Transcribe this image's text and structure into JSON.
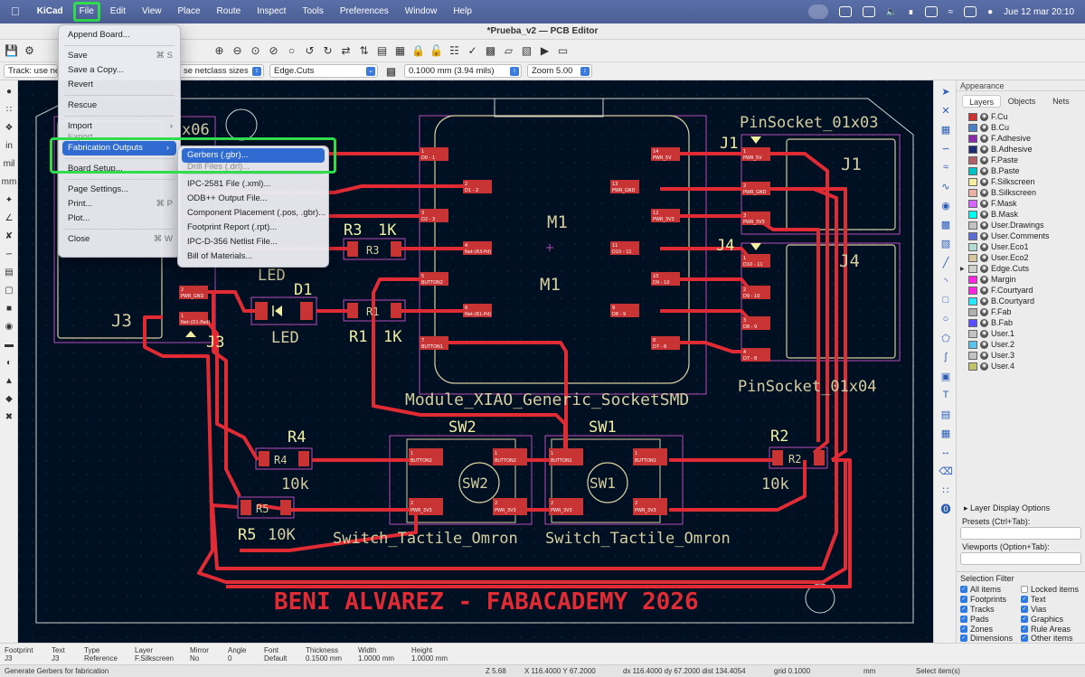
{
  "menubar": {
    "apple": "",
    "app": "KiCad",
    "items": [
      "File",
      "Edit",
      "View",
      "Place",
      "Route",
      "Inspect",
      "Tools",
      "Preferences",
      "Window",
      "Help"
    ],
    "datetime": "Jue 12 mar 20:10"
  },
  "window": {
    "title": "*Prueba_v2 — PCB Editor"
  },
  "toolbar2": {
    "track": "Track: use net",
    "via": "se netclass sizes",
    "layer": "Edge.Cuts",
    "grid": "0.1000 mm (3.94 mils)",
    "zoom": "Zoom 5.00"
  },
  "file_menu": {
    "items": [
      {
        "label": "Append Board...",
        "shortcut": ""
      },
      {
        "label": "Save",
        "shortcut": "⌘ S"
      },
      {
        "label": "Save a Copy...",
        "shortcut": ""
      },
      {
        "label": "Revert",
        "shortcut": ""
      },
      {
        "label": "Rescue",
        "shortcut": ""
      },
      {
        "label": "Import",
        "shortcut": ""
      },
      {
        "label": "Export",
        "shortcut": ""
      },
      {
        "label": "Fabrication Outputs",
        "shortcut": ""
      },
      {
        "label": "Board Setup...",
        "shortcut": ""
      },
      {
        "label": "Page Settings...",
        "shortcut": ""
      },
      {
        "label": "Print...",
        "shortcut": "⌘ P"
      },
      {
        "label": "Plot...",
        "shortcut": ""
      },
      {
        "label": "Close",
        "shortcut": "⌘ W"
      }
    ]
  },
  "fab_menu": {
    "items": [
      "Gerbers (.gbr)...",
      "Drill Files (.drl)...",
      "IPC-2581 File (.xml)...",
      "ODB++ Output File...",
      "Component Placement (.pos, .gbr)...",
      "Footprint Report (.rpt)...",
      "IPC-D-356 Netlist File...",
      "Bill of Materials..."
    ]
  },
  "pcb": {
    "refs": {
      "j1": "J1",
      "j1_name": "PinSocket_01x03",
      "j4": "J4",
      "j4_name": "PinSocket_01x04",
      "j3": "J3",
      "m1": "M1",
      "m1_name": "Module_XIAO_Generic_SocketSMD",
      "r3": "R3",
      "r3_val": "1K",
      "d1": "D1",
      "d1_val": "LED",
      "r1": "R1",
      "r1_val": "1K",
      "r4": "R4",
      "r4_val": "10k",
      "r5": "R5",
      "r5_val": "10K",
      "sw1": "SW1",
      "sw2": "SW2",
      "sw_name": "Switch_Tactile_Omron",
      "r2": "R2",
      "r2_val": "10k",
      "j3_name_part": "x06",
      "footer": "BENI ALVAREZ - FABACADEMY 2026"
    },
    "m1_left_pads": [
      {
        "num": "1",
        "net": "D0 - 1"
      },
      {
        "num": "2",
        "net": "D1 - 2"
      },
      {
        "num": "3",
        "net": "D2 - 3"
      },
      {
        "num": "4",
        "net": "Net-(R3-Pd)"
      },
      {
        "num": "5",
        "net": "BUTTON2"
      },
      {
        "num": "6",
        "net": "Net-(R1-Pd)"
      },
      {
        "num": "7",
        "net": "BUTTON1"
      }
    ],
    "m1_right_pads": [
      {
        "num": "14",
        "net": "PWR_5V"
      },
      {
        "num": "13",
        "net": "PWR_GND"
      },
      {
        "num": "12",
        "net": "PWR_3V3"
      },
      {
        "num": "11",
        "net": "D10 - 11"
      },
      {
        "num": "10",
        "net": "D9 - 10"
      },
      {
        "num": "9",
        "net": "D8 - 9"
      },
      {
        "num": "8",
        "net": "D7 - 8"
      }
    ],
    "j1_pads": [
      {
        "num": "1",
        "net": "PWR_5V"
      },
      {
        "num": "2",
        "net": "PWR_GND"
      },
      {
        "num": "3",
        "net": "PWR_3V3"
      }
    ],
    "j4_pads": [
      {
        "num": "1",
        "net": "D10 - 11"
      },
      {
        "num": "2",
        "net": "D9 - 10"
      },
      {
        "num": "3",
        "net": "D8 - 9"
      },
      {
        "num": "4",
        "net": "D7 - 8"
      }
    ],
    "j3_pads": [
      {
        "num": "2",
        "net": "PWR_GND"
      },
      {
        "num": "1",
        "net": "Net-(D1-Pad)"
      }
    ],
    "sw_pads": {
      "p1a": "BUTTON2",
      "p1b": "BUTTON2",
      "p2a": "PWR_3V3",
      "p2b": "PWR_3V3",
      "q1a": "BUTTON1",
      "q1b": "BUTTON1",
      "q2a": "PWR_3V3",
      "q2b": "PWR_3V3"
    },
    "misc": {
      "one": "1",
      "two": "2",
      "sw_btn": "BUTTON"
    }
  },
  "appearance": {
    "title": "Appearance",
    "tabs": [
      "Layers",
      "Objects",
      "Nets"
    ],
    "layers": [
      {
        "name": "F.Cu",
        "color": "#c83434"
      },
      {
        "name": "B.Cu",
        "color": "#4d7fc4"
      },
      {
        "name": "F.Adhesive",
        "color": "#8a2ba8"
      },
      {
        "name": "B.Adhesive",
        "color": "#1c2c6e"
      },
      {
        "name": "F.Paste",
        "color": "#b45f6a"
      },
      {
        "name": "B.Paste",
        "color": "#00c2c2"
      },
      {
        "name": "F.Silkscreen",
        "color": "#f2eda1"
      },
      {
        "name": "B.Silkscreen",
        "color": "#e8b2a7"
      },
      {
        "name": "F.Mask",
        "color": "#d864ff"
      },
      {
        "name": "B.Mask",
        "color": "#02ffee"
      },
      {
        "name": "User.Drawings",
        "color": "#c2c2c2"
      },
      {
        "name": "User.Comments",
        "color": "#596dd4"
      },
      {
        "name": "User.Eco1",
        "color": "#b4dbd2"
      },
      {
        "name": "User.Eco2",
        "color": "#d8c8a0"
      },
      {
        "name": "Edge.Cuts",
        "color": "#d0d2cd"
      },
      {
        "name": "Margin",
        "color": "#ff26e2"
      },
      {
        "name": "F.Courtyard",
        "color": "#ff26e2"
      },
      {
        "name": "B.Courtyard",
        "color": "#26e9ff"
      },
      {
        "name": "F.Fab",
        "color": "#afafaf"
      },
      {
        "name": "B.Fab",
        "color": "#584dff"
      },
      {
        "name": "User.1",
        "color": "#c2c2c2"
      },
      {
        "name": "User.2",
        "color": "#59c5e8"
      },
      {
        "name": "User.3",
        "color": "#c2c2c2"
      },
      {
        "name": "User.4",
        "color": "#c2c26a"
      }
    ],
    "layer_display_options": "Layer Display Options",
    "presets_label": "Presets (Ctrl+Tab):",
    "viewports_label": "Viewports (Option+Tab):",
    "selection_filter_title": "Selection Filter",
    "selection_filter": [
      {
        "label": "All items",
        "checked": true
      },
      {
        "label": "Locked items",
        "checked": false
      },
      {
        "label": "Footprints",
        "checked": true
      },
      {
        "label": "Text",
        "checked": true
      },
      {
        "label": "Tracks",
        "checked": true
      },
      {
        "label": "Vias",
        "checked": true
      },
      {
        "label": "Pads",
        "checked": true
      },
      {
        "label": "Graphics",
        "checked": true
      },
      {
        "label": "Zones",
        "checked": true
      },
      {
        "label": "Rule Areas",
        "checked": true
      },
      {
        "label": "Dimensions",
        "checked": true
      },
      {
        "label": "Other items",
        "checked": true
      }
    ]
  },
  "info": {
    "footprint_h": "Footprint",
    "footprint_v": "J3",
    "text_h": "Text",
    "text_v": "J3",
    "type_h": "Type",
    "type_v": "Reference",
    "layer_h": "Layer",
    "layer_v": "F.Silkscreen",
    "mirror_h": "Mirror",
    "mirror_v": "No",
    "angle_h": "Angle",
    "angle_v": "0",
    "font_h": "Font",
    "font_v": "Default",
    "thickness_h": "Thickness",
    "thickness_v": "0.1500 mm",
    "width_h": "Width",
    "width_v": "1.0000 mm",
    "height_h": "Height",
    "height_v": "1.0000 mm"
  },
  "status": {
    "message": "Generate Gerbers for fabrication",
    "z": "Z 5.68",
    "xy": "X 116.4000  Y 67.2000",
    "dxy": "dx 116.4000  dy 67.2000  dist 134.4054",
    "grid": "grid 0.1000",
    "units": "mm",
    "mode": "Select item(s)"
  }
}
